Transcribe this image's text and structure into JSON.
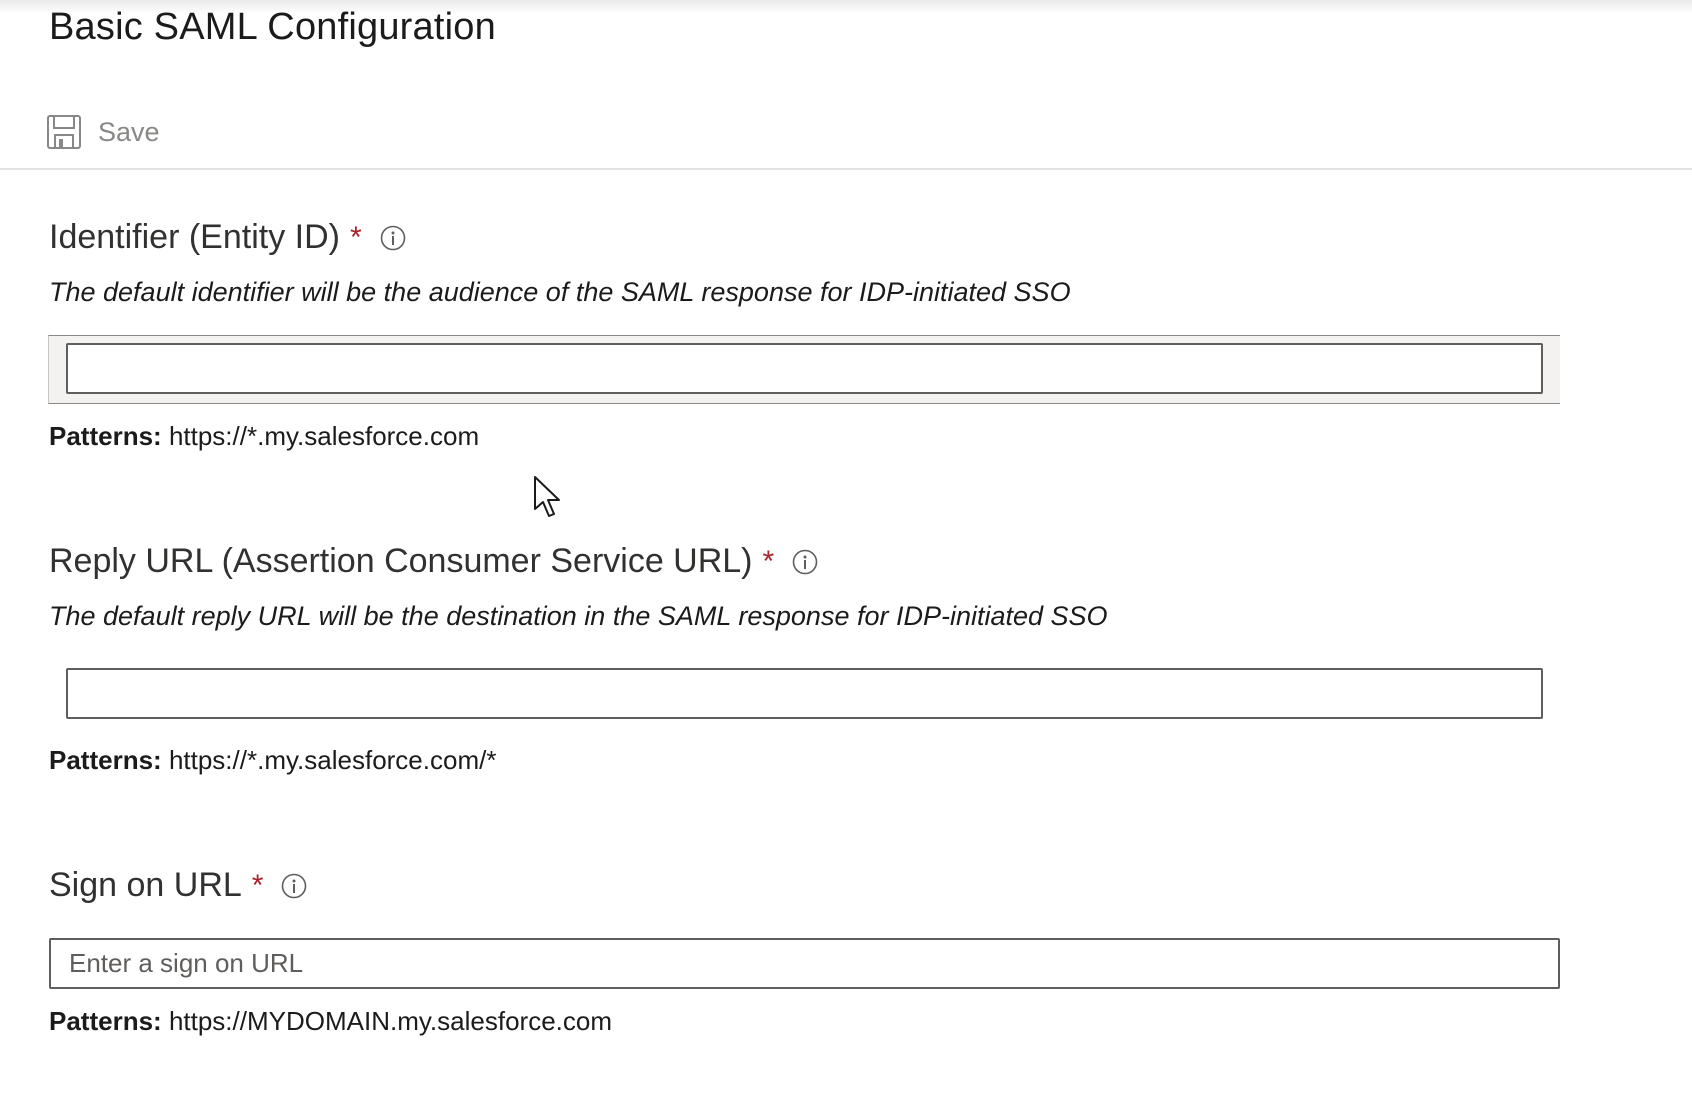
{
  "header": {
    "title": "Basic SAML Configuration",
    "save_label": "Save"
  },
  "fields": {
    "identifier": {
      "label": "Identifier (Entity ID)",
      "required_mark": "*",
      "description": "The default identifier will be the audience of the SAML response for IDP-initiated SSO",
      "value": "",
      "pattern_label": "Patterns:",
      "pattern_value": "https://*.my.salesforce.com"
    },
    "reply_url": {
      "label": "Reply URL (Assertion Consumer Service URL)",
      "required_mark": "*",
      "description": "The default reply URL will be the destination in the SAML response for IDP-initiated SSO",
      "value": "",
      "pattern_label": "Patterns:",
      "pattern_value": "https://*.my.salesforce.com/*"
    },
    "sign_on_url": {
      "label": "Sign on URL",
      "required_mark": "*",
      "placeholder": "Enter a sign on URL",
      "value": "",
      "pattern_label": "Patterns:",
      "pattern_value": "https://MYDOMAIN.my.salesforce.com"
    }
  },
  "icons": {
    "save": "save-icon",
    "info": "info-icon",
    "cursor": "mouse-pointer-icon"
  },
  "colors": {
    "required": "#a4262c",
    "input_border": "#605e5c",
    "save_label": "#8a8886"
  }
}
